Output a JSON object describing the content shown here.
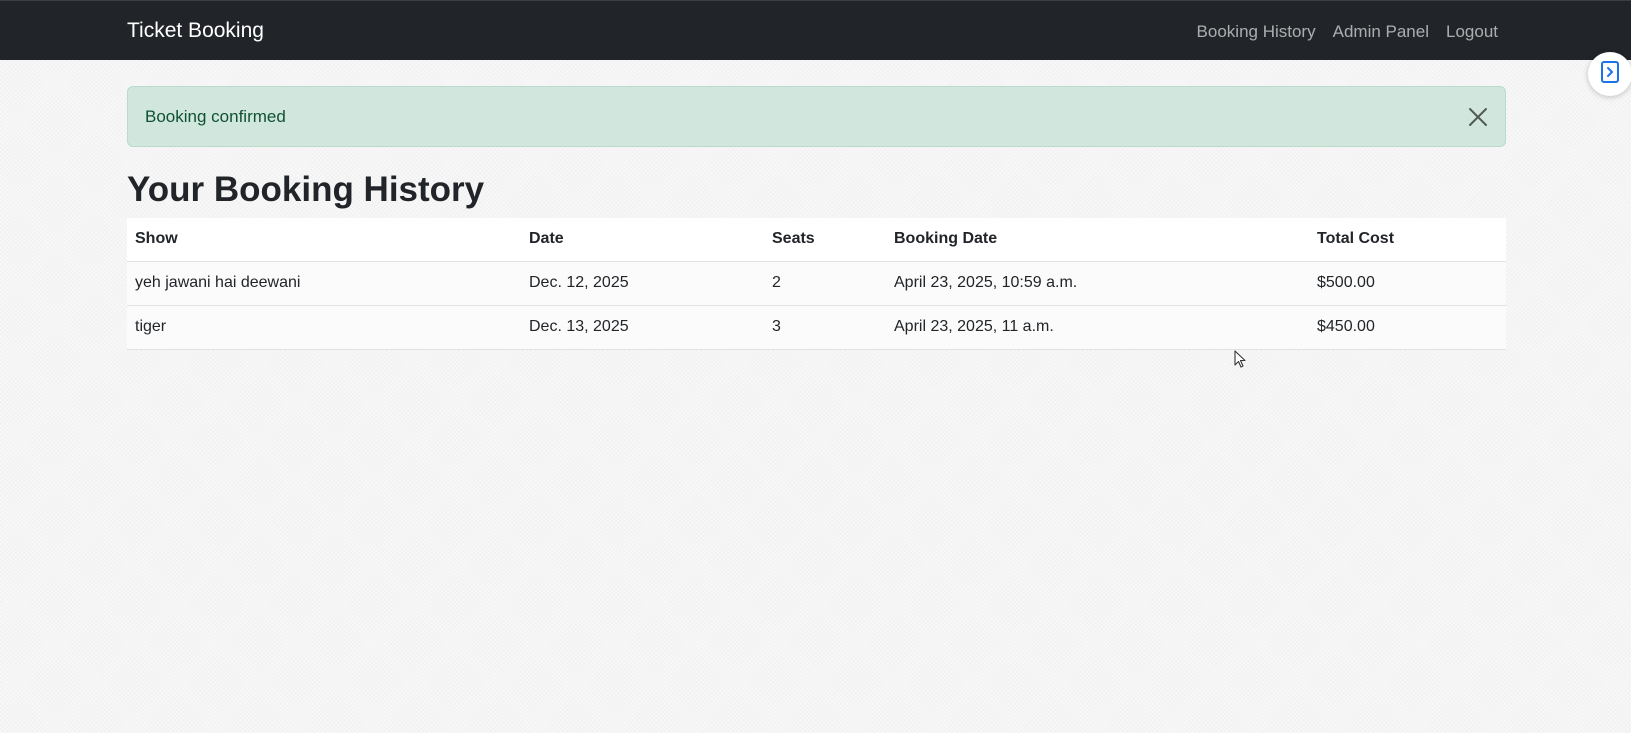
{
  "navbar": {
    "brand": "Ticket Booking",
    "links": [
      {
        "label": "Booking History"
      },
      {
        "label": "Admin Panel"
      },
      {
        "label": "Logout"
      }
    ]
  },
  "alert": {
    "message": "Booking confirmed",
    "close_icon": "close-icon"
  },
  "page": {
    "title": "Your Booking History"
  },
  "table": {
    "columns": [
      "Show",
      "Date",
      "Seats",
      "Booking Date",
      "Total Cost"
    ],
    "rows": [
      [
        "yeh jawani hai deewani",
        "Dec. 12, 2025",
        "2",
        "April 23, 2025, 10:59 a.m.",
        "$500.00"
      ],
      [
        "tiger",
        "Dec. 13, 2025",
        "3",
        "April 23, 2025, 11 a.m.",
        "$450.00"
      ]
    ]
  },
  "widgets": {
    "side_button_icon": "document-arrow-icon",
    "cursor_icon": "mouse-pointer-icon"
  },
  "colors": {
    "navbar_bg": "#212529",
    "alert_bg": "#d1e7dd",
    "alert_text": "#0f5132",
    "widget_accent": "#1a73e8"
  }
}
